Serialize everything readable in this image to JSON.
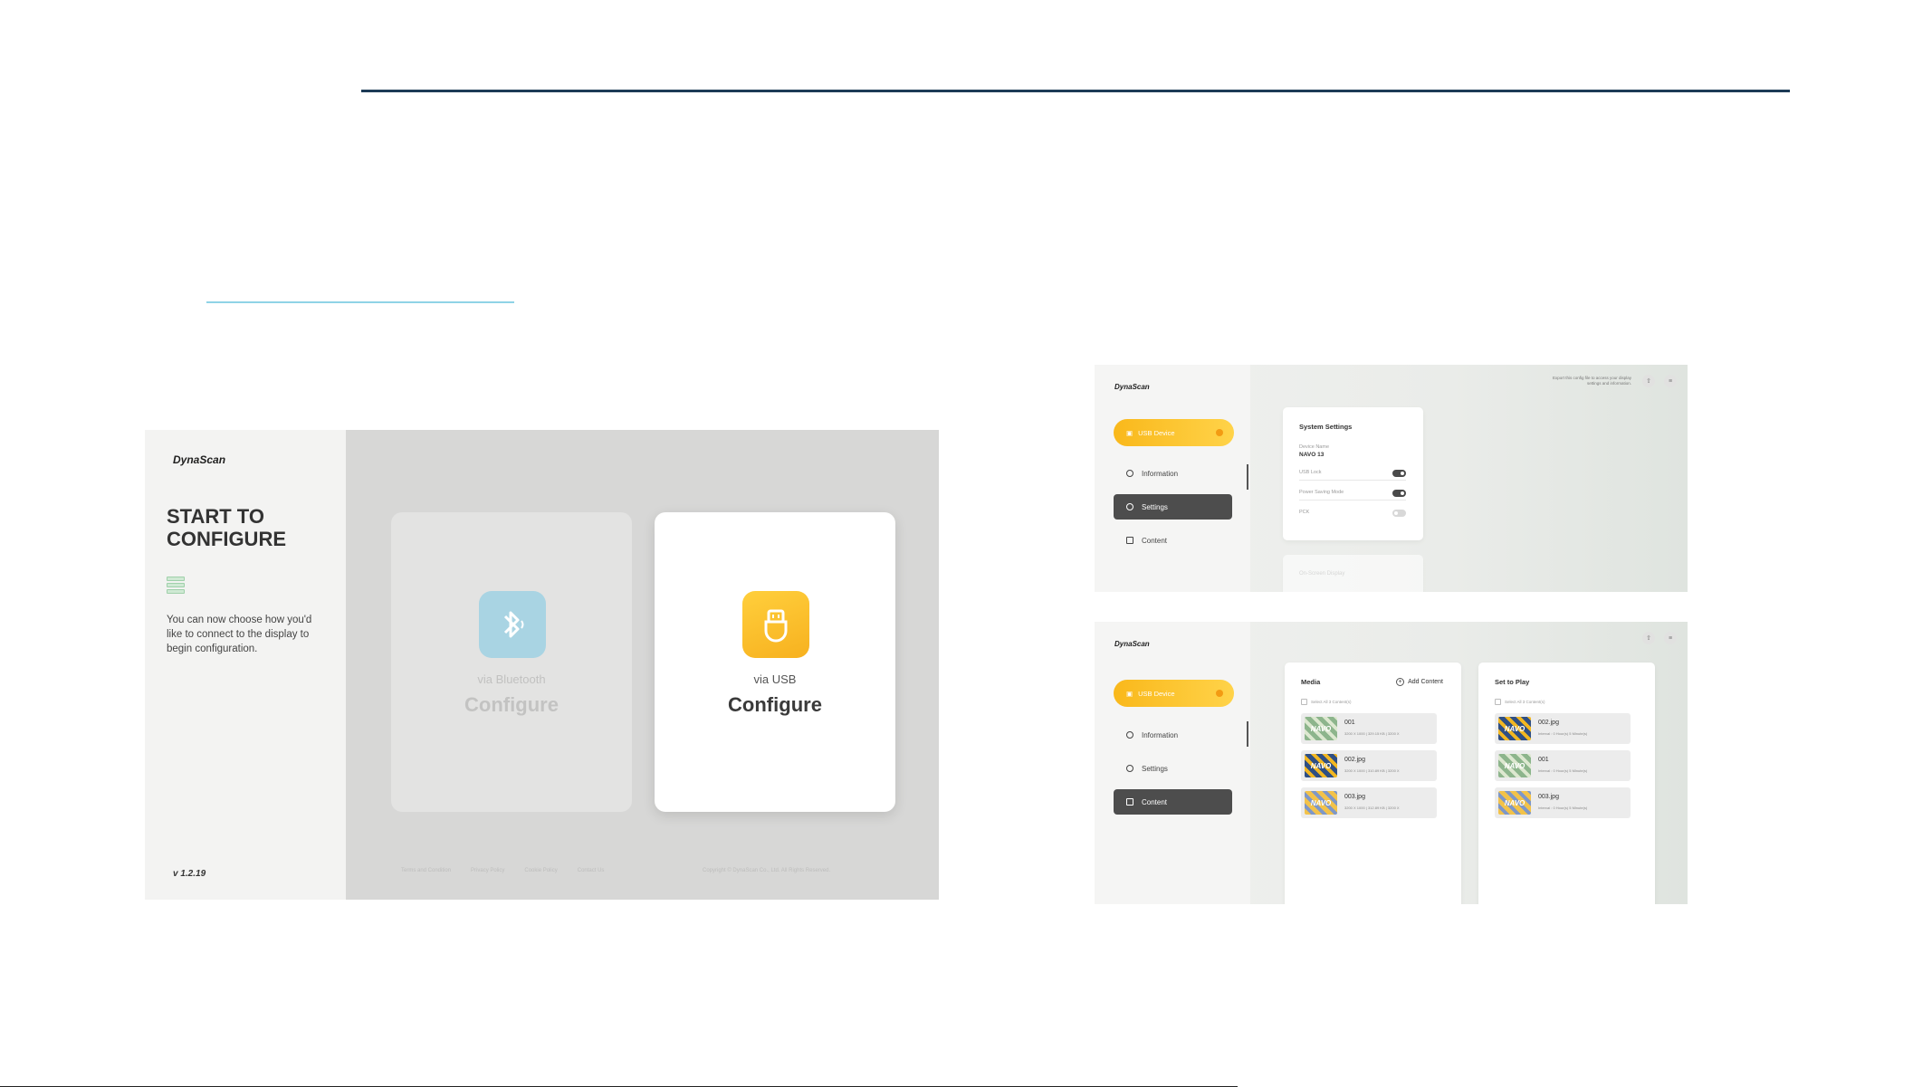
{
  "brand": {
    "logo_text": "DynaScan"
  },
  "main_screen": {
    "headline_line1": "START TO",
    "headline_line2": "CONFIGURE",
    "description": "You can now choose how you'd like to connect to the display to begin configuration.",
    "version": "v 1.2.19",
    "options": [
      {
        "via": "via Bluetooth",
        "action": "Configure",
        "icon": "bluetooth-icon",
        "state": "disabled"
      },
      {
        "via": "via USB",
        "action": "Configure",
        "icon": "usb-icon",
        "state": "enabled"
      }
    ],
    "footer_links": [
      "Terms and Condition",
      "Privacy Policy",
      "Cookie Policy",
      "Contact Us"
    ],
    "copyright": "Copyright © DynaScan Co., Ltd. All Rights Reserved."
  },
  "settings_screen": {
    "device_pill": "USB Device",
    "nav": [
      "Information",
      "Settings",
      "Content"
    ],
    "active_nav": "Settings",
    "header_note": "Export this config file to access your display settings and information.",
    "panel_title": "System Settings",
    "device_name_label": "Device Name",
    "device_name_value": "NAVO 13",
    "toggles": [
      {
        "label": "USB Lock",
        "on": true
      },
      {
        "label": "Power Saving Mode",
        "on": true
      },
      {
        "label": "PCK",
        "on": false
      }
    ],
    "next_panel_label": "On-Screen Display"
  },
  "content_screen": {
    "device_pill": "USB Device",
    "nav": [
      "Information",
      "Settings",
      "Content"
    ],
    "active_nav": "Content",
    "media_panel": {
      "title": "Media",
      "add_label": "Add Content",
      "select_all": "Select All 3 Content(s)",
      "items": [
        {
          "name": "001",
          "meta": "3200 X 1000 | 329.15 KB | 3200 X",
          "thumb": "green"
        },
        {
          "name": "002.jpg",
          "meta": "3200 X 1000 | 310.89 KB | 3200 X",
          "thumb": "blue"
        },
        {
          "name": "003.jpg",
          "meta": "3200 X 1000 | 312.89 KB | 3200 X",
          "thumb": "yellow"
        }
      ]
    },
    "play_panel": {
      "title": "Set to Play",
      "select_all": "Select All 3 Content(s)",
      "items": [
        {
          "name": "002.jpg",
          "meta": "Interval : 0 Hour(s) 5 Minute(s)",
          "thumb": "blue"
        },
        {
          "name": "001",
          "meta": "Interval : 0 Hour(s) 5 Minute(s)",
          "thumb": "green"
        },
        {
          "name": "003.jpg",
          "meta": "Interval : 0 Hour(s) 5 Minute(s)",
          "thumb": "yellow"
        }
      ]
    }
  },
  "thumb_text": "NAVO",
  "colors": {
    "accent_yellow": "#f9b81b",
    "rule_navy": "#1d3b56",
    "rule_cyan": "#8fd3e6",
    "bluetooth_blue": "#a9d4e3"
  }
}
